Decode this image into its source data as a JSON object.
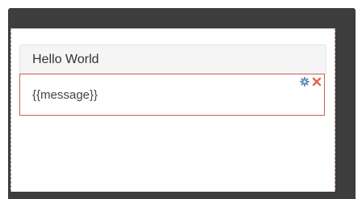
{
  "widget": {
    "title": "Hello World",
    "body_text": "{{message}}"
  },
  "controls": {
    "settings_icon": "gear-icon",
    "remove_icon": "close-icon"
  },
  "colors": {
    "frame": "#3d3d3d",
    "selection_border": "#cc5c55",
    "settings_icon": "#5b8fbf",
    "remove_icon": "#e0664f"
  }
}
